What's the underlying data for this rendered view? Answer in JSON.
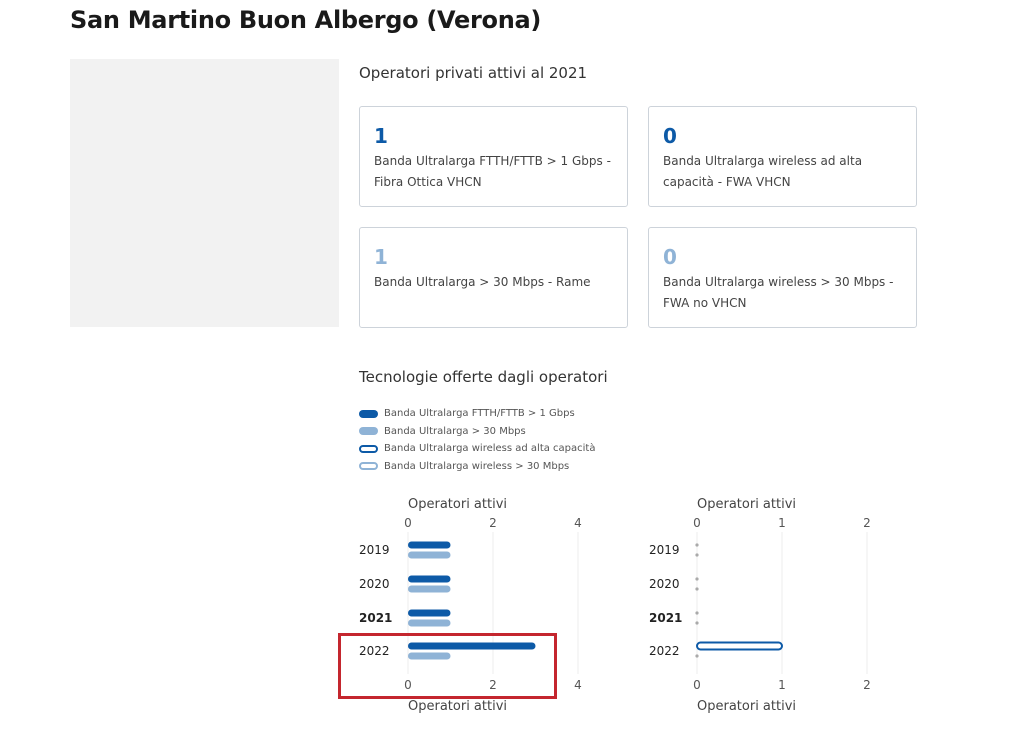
{
  "page": {
    "title": "San Martino Buon Albergo (Verona)"
  },
  "operators_section": {
    "title": "Operatori privati attivi al 2021",
    "cards": [
      {
        "value": "1",
        "label_line1": "Banda Ultralarga FTTH/FTTB > 1 Gbps -",
        "label_line2": "Fibra Ottica VHCN",
        "tone": "dark"
      },
      {
        "value": "0",
        "label_line1": "Banda Ultralarga wireless ad alta",
        "label_line2": "capacità - FWA VHCN",
        "tone": "dark"
      },
      {
        "value": "1",
        "label_line1": "Banda Ultralarga > 30 Mbps - Rame",
        "label_line2": "",
        "tone": "light"
      },
      {
        "value": "0",
        "label_line1": "Banda Ultralarga wireless > 30 Mbps -",
        "label_line2": "FWA no VHCN",
        "tone": "light"
      }
    ]
  },
  "tech_section": {
    "title": "Tecnologie offerte dagli operatori",
    "legend": [
      {
        "label": "Banda Ultralarga FTTH/FTTB > 1 Gbps",
        "style": "filled",
        "color": "#0d5aa7"
      },
      {
        "label": "Banda Ultralarga > 30 Mbps",
        "style": "filled",
        "color": "#8fb3d6"
      },
      {
        "label": "Banda Ultralarga wireless ad alta capacità",
        "style": "outline",
        "color": "#0d5aa7"
      },
      {
        "label": "Banda Ultralarga wireless > 30 Mbps",
        "style": "outline",
        "color": "#8fb3d6"
      }
    ]
  },
  "chart_data": [
    {
      "type": "bar",
      "orientation": "horizontal",
      "axis_title_top": "Operatori attivi",
      "axis_title_bottom": "Operatori attivi",
      "xlim": [
        0,
        4
      ],
      "ticks": [
        "0",
        "2",
        "4"
      ],
      "categories": [
        "2019",
        "2020",
        "2021",
        "2022"
      ],
      "bold_category": "2021",
      "series": [
        {
          "name": "Banda Ultralarga FTTH/FTTB > 1 Gbps",
          "color": "#0d5aa7",
          "style": "filled",
          "values": [
            1,
            1,
            1,
            3
          ]
        },
        {
          "name": "Banda Ultralarga > 30 Mbps",
          "color": "#8fb3d6",
          "style": "filled",
          "values": [
            1,
            1,
            1,
            1
          ]
        }
      ]
    },
    {
      "type": "bar",
      "orientation": "horizontal",
      "axis_title_top": "Operatori attivi",
      "axis_title_bottom": "Operatori attivi",
      "xlim": [
        0,
        2
      ],
      "ticks": [
        "0",
        "1",
        "2"
      ],
      "categories": [
        "2019",
        "2020",
        "2021",
        "2022"
      ],
      "bold_category": "2021",
      "series": [
        {
          "name": "Banda Ultralarga wireless ad alta capacità",
          "color": "#0d5aa7",
          "style": "outline",
          "values": [
            0,
            0,
            0,
            1
          ]
        },
        {
          "name": "Banda Ultralarga wireless > 30 Mbps",
          "color": "#8fb3d6",
          "style": "outline",
          "values": [
            0,
            0,
            0,
            0
          ]
        }
      ]
    }
  ],
  "highlight": {
    "color": "#c4262e",
    "target": "2022"
  }
}
